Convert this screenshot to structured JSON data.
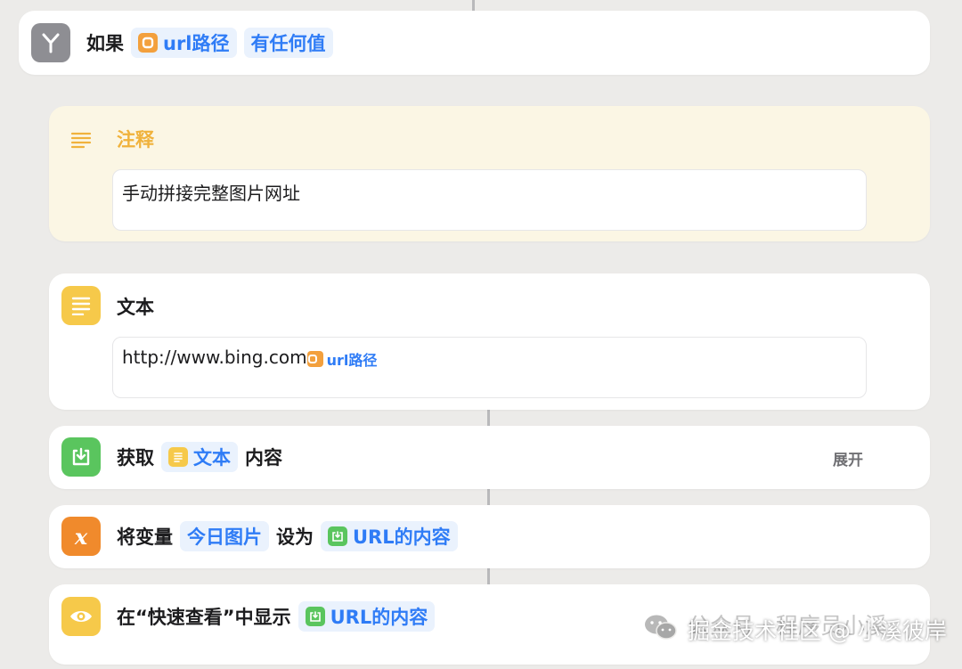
{
  "if_action": {
    "label_if": "如果",
    "variable": "url路径",
    "condition": "有任何值"
  },
  "comment_action": {
    "title": "注释",
    "text": "手动拼接完整图片网址"
  },
  "text_action": {
    "title": "文本",
    "content_prefix": "http://www.bing.com",
    "content_variable": "url路径"
  },
  "get_action": {
    "label_get": "获取",
    "source": "文本",
    "label_content": "内容",
    "expand": "展开"
  },
  "set_var_action": {
    "label_set": "将变量",
    "variable": "今日图片",
    "label_to": "设为",
    "value": "URL的内容"
  },
  "quicklook_action": {
    "label": "在“快速查看”中显示",
    "value": "URL的内容"
  },
  "watermark": {
    "faded": "公众号 · 程序员小溪",
    "main": "掘金技术社区 @ 小溪彼岸"
  },
  "colors": {
    "token_blue": "#2f7cf6",
    "if_gray": "#8e8e93",
    "comment_yellow": "#f6c94a",
    "get_green": "#5ac55e",
    "variable_orange": "#f08a2c"
  }
}
